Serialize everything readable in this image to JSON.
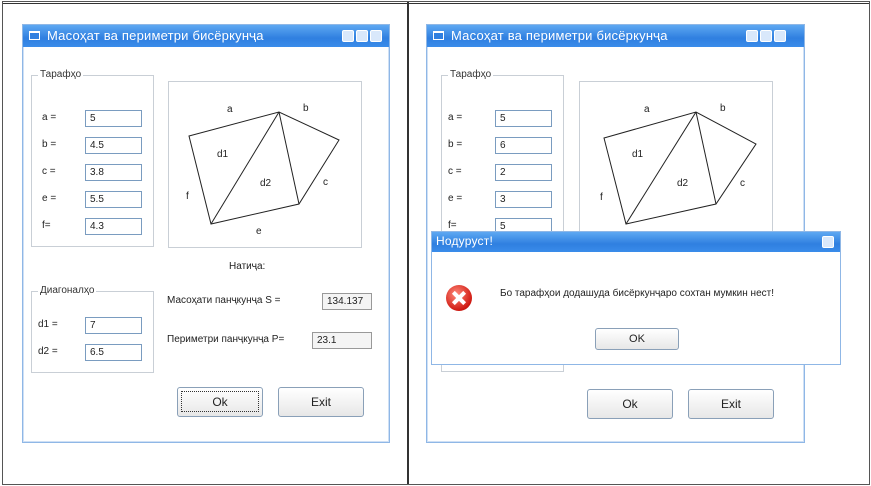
{
  "left_window": {
    "title": "Масоҳат ва периметри бисёркунҷа",
    "sides_group": "Тарафҳо",
    "labels": {
      "a": "a =",
      "b": "b =",
      "c": "c =",
      "e": "e =",
      "f": "f="
    },
    "values": {
      "a": "5",
      "b": "4.5",
      "c": "3.8",
      "e": "5.5",
      "f": "4.3"
    },
    "diag_group": "Диагоналҳо",
    "diag_labels": {
      "d1": "d1 =",
      "d2": "d2 ="
    },
    "diag_values": {
      "d1": "7",
      "d2": "6.5"
    },
    "result_heading": "Натиҷа:",
    "area_label": "Масоҳати панҷкунҷа S =",
    "area_value": "134.137",
    "perimeter_label": "Периметри панҷкунҷа P=",
    "perimeter_value": "23.1",
    "ok_button": "Ok",
    "exit_button": "Exit"
  },
  "right_window": {
    "title": "Масоҳат ва периметри бисёркунҷа",
    "sides_group": "Тарафҳо",
    "labels": {
      "a": "a =",
      "b": "b =",
      "c": "c =",
      "e": "e =",
      "f": "f="
    },
    "values": {
      "a": "5",
      "b": "6",
      "c": "2",
      "e": "3",
      "f": "5"
    },
    "ok_button": "Ok",
    "exit_button": "Exit"
  },
  "diagram_labels": {
    "a": "a",
    "b": "b",
    "c": "c",
    "d1": "d1",
    "d2": "d2",
    "e": "e",
    "f": "f"
  },
  "message_box": {
    "title": "Нодуруст!",
    "text": "Бо тарафҳои додашуда бисёркунҷаро сохтан мумкин нест!",
    "ok_button": "OK"
  },
  "colors": {
    "titlebar": "#2f7fe0",
    "error_icon": "#d01a12"
  }
}
